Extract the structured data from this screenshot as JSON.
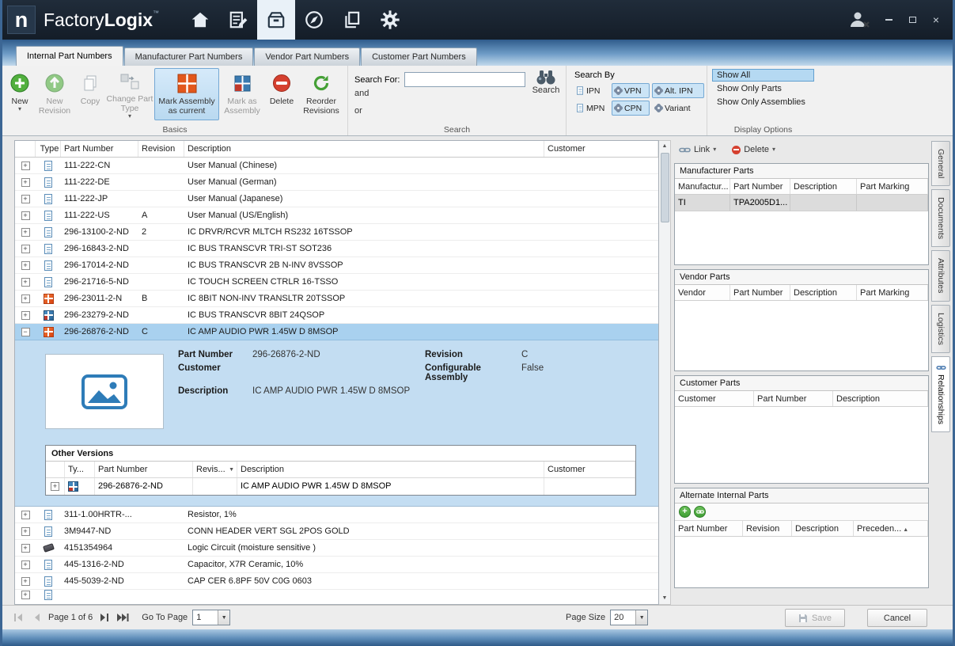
{
  "titlebar": {
    "logo": "n",
    "brand_1": "Factory",
    "brand_2": "Logix",
    "trademark": "™"
  },
  "window_controls": {
    "close": "×"
  },
  "tabs": [
    {
      "label": "Internal Part Numbers"
    },
    {
      "label": "Manufacturer Part Numbers"
    },
    {
      "label": "Vendor Part Numbers"
    },
    {
      "label": "Customer Part Numbers"
    }
  ],
  "ribbon": {
    "basics": {
      "group_label": "Basics",
      "new": "New",
      "new_revision": "New Revision",
      "copy": "Copy",
      "change_part_type": "Change Part Type",
      "mark_assembly_current": "Mark Assembly as current",
      "mark_as_assembly": "Mark as Assembly",
      "delete": "Delete",
      "reorder_revisions": "Reorder Revisions"
    },
    "search": {
      "group_label": "Search",
      "search_for_label": "Search For:",
      "search_value": "",
      "and_label": "and",
      "or_label": "or",
      "search_button": "Search"
    },
    "search_by": {
      "label": "Search By",
      "ipn": "IPN",
      "vpn": "VPN",
      "alt_ipn": "Alt. IPN",
      "mpn": "MPN",
      "cpn": "CPN",
      "variant": "Variant"
    },
    "display_options": {
      "group_label": "Display Options",
      "show_all": "Show All",
      "show_only_parts": "Show Only Parts",
      "show_only_assemblies": "Show Only Assemblies"
    }
  },
  "main_table": {
    "columns": {
      "type": "Type",
      "part_number": "Part Number",
      "revision": "Revision",
      "description": "Description",
      "customer": "Customer"
    },
    "rows": [
      {
        "expand": "+",
        "type_icon": "document",
        "part_number": "111-222-CN",
        "revision": "",
        "description": "User Manual (Chinese)",
        "customer": ""
      },
      {
        "expand": "+",
        "type_icon": "document",
        "part_number": "111-222-DE",
        "revision": "",
        "description": "User Manual (German)",
        "customer": ""
      },
      {
        "expand": "+",
        "type_icon": "document",
        "part_number": "111-222-JP",
        "revision": "",
        "description": "User Manual (Japanese)",
        "customer": ""
      },
      {
        "expand": "+",
        "type_icon": "document",
        "part_number": "111-222-US",
        "revision": "A",
        "description": "User Manual (US/English)",
        "customer": ""
      },
      {
        "expand": "+",
        "type_icon": "document",
        "part_number": "296-13100-2-ND",
        "revision": "2",
        "description": "IC DRVR/RCVR MLTCH RS232 16TSSOP",
        "customer": ""
      },
      {
        "expand": "+",
        "type_icon": "document",
        "part_number": "296-16843-2-ND",
        "revision": "",
        "description": "IC BUS TRANSCVR TRI-ST SOT236",
        "customer": ""
      },
      {
        "expand": "+",
        "type_icon": "document",
        "part_number": "296-17014-2-ND",
        "revision": "",
        "description": "IC BUS TRANSCVR 2B N-INV 8VSSOP",
        "customer": ""
      },
      {
        "expand": "+",
        "type_icon": "document",
        "part_number": "296-21716-5-ND",
        "revision": "",
        "description": "IC TOUCH SCREEN CTRLR 16-TSSO",
        "customer": ""
      },
      {
        "expand": "+",
        "type_icon": "assembly",
        "part_number": "296-23011-2-N",
        "revision": "B",
        "description": "IC 8BIT NON-INV TRANSLTR 20TSSOP",
        "customer": ""
      },
      {
        "expand": "+",
        "type_icon": "board",
        "part_number": "296-23279-2-ND",
        "revision": "",
        "description": "IC BUS TRANSCVR 8BIT 24QSOP",
        "customer": ""
      },
      {
        "expand": "−",
        "type_icon": "assembly",
        "part_number": "296-26876-2-ND",
        "revision": "C",
        "description": "IC AMP AUDIO PWR 1.45W D 8MSOP",
        "customer": ""
      },
      {
        "expand": "+",
        "type_icon": "document",
        "part_number": "311-1.00HRTR-...",
        "revision": "",
        "description": "Resistor, 1%",
        "customer": ""
      },
      {
        "expand": "+",
        "type_icon": "document",
        "part_number": "3M9447-ND",
        "revision": "",
        "description": "CONN HEADER VERT SGL 2POS GOLD",
        "customer": ""
      },
      {
        "expand": "+",
        "type_icon": "chip",
        "part_number": "4151354964",
        "revision": "",
        "description": "Logic Circuit (moisture sensitive )",
        "customer": ""
      },
      {
        "expand": "+",
        "type_icon": "document",
        "part_number": "445-1316-2-ND",
        "revision": "",
        "description": "Capacitor, X7R Ceramic, 10%",
        "customer": ""
      },
      {
        "expand": "+",
        "type_icon": "document",
        "part_number": "445-5039-2-ND",
        "revision": "",
        "description": "CAP CER 6.8PF 50V C0G 0603",
        "customer": ""
      }
    ]
  },
  "detail": {
    "part_number_label": "Part Number",
    "part_number": "296-26876-2-ND",
    "revision_label": "Revision",
    "revision": "C",
    "customer_label": "Customer",
    "customer": "",
    "configurable_assembly_label": "Configurable Assembly",
    "configurable_assembly": "False",
    "description_label": "Description",
    "description": "IC AMP AUDIO PWR 1.45W D 8MSOP",
    "other_versions": {
      "title": "Other Versions",
      "columns": {
        "type": "Ty...",
        "part_number": "Part Number",
        "revision": "Revis...",
        "description": "Description",
        "customer": "Customer"
      },
      "rows": [
        {
          "expand": "+",
          "type_icon": "board",
          "part_number": "296-26876-2-ND",
          "revision": "",
          "description": "IC AMP AUDIO PWR 1.45W D 8MSOP",
          "customer": ""
        }
      ]
    }
  },
  "relationships_panel": {
    "link_button": "Link",
    "delete_button": "Delete",
    "manufacturer_parts": {
      "title": "Manufacturer Parts",
      "columns": [
        "Manufactur...",
        "Part Number",
        "Description",
        "Part Marking"
      ],
      "rows": [
        {
          "manufacturer": "TI",
          "part_number": "TPA2005D1...",
          "description": "",
          "part_marking": ""
        }
      ]
    },
    "vendor_parts": {
      "title": "Vendor Parts",
      "columns": [
        "Vendor",
        "Part Number",
        "Description",
        "Part Marking"
      ],
      "rows": []
    },
    "customer_parts": {
      "title": "Customer Parts",
      "columns": [
        "Customer",
        "Part Number",
        "Description"
      ],
      "rows": []
    },
    "alternate_internal_parts": {
      "title": "Alternate Internal Parts",
      "columns": [
        "Part Number",
        "Revision",
        "Description",
        "Preceden..."
      ],
      "rows": []
    }
  },
  "side_tabs": [
    {
      "label": "General"
    },
    {
      "label": "Documents"
    },
    {
      "label": "Attributes"
    },
    {
      "label": "Logistics"
    },
    {
      "label": "Relationships"
    }
  ],
  "footer": {
    "page_label": "Page 1 of 6",
    "goto_label": "Go To Page",
    "goto_value": "1",
    "page_size_label": "Page Size",
    "page_size_value": "20",
    "save": "Save",
    "cancel": "Cancel"
  },
  "icons": {
    "dropdown": "▾",
    "filter_caret": "▼",
    "sort_asc_caret": "▲",
    "expand_plus": "+",
    "scroll_up": "▲",
    "scroll_down": "▼"
  }
}
